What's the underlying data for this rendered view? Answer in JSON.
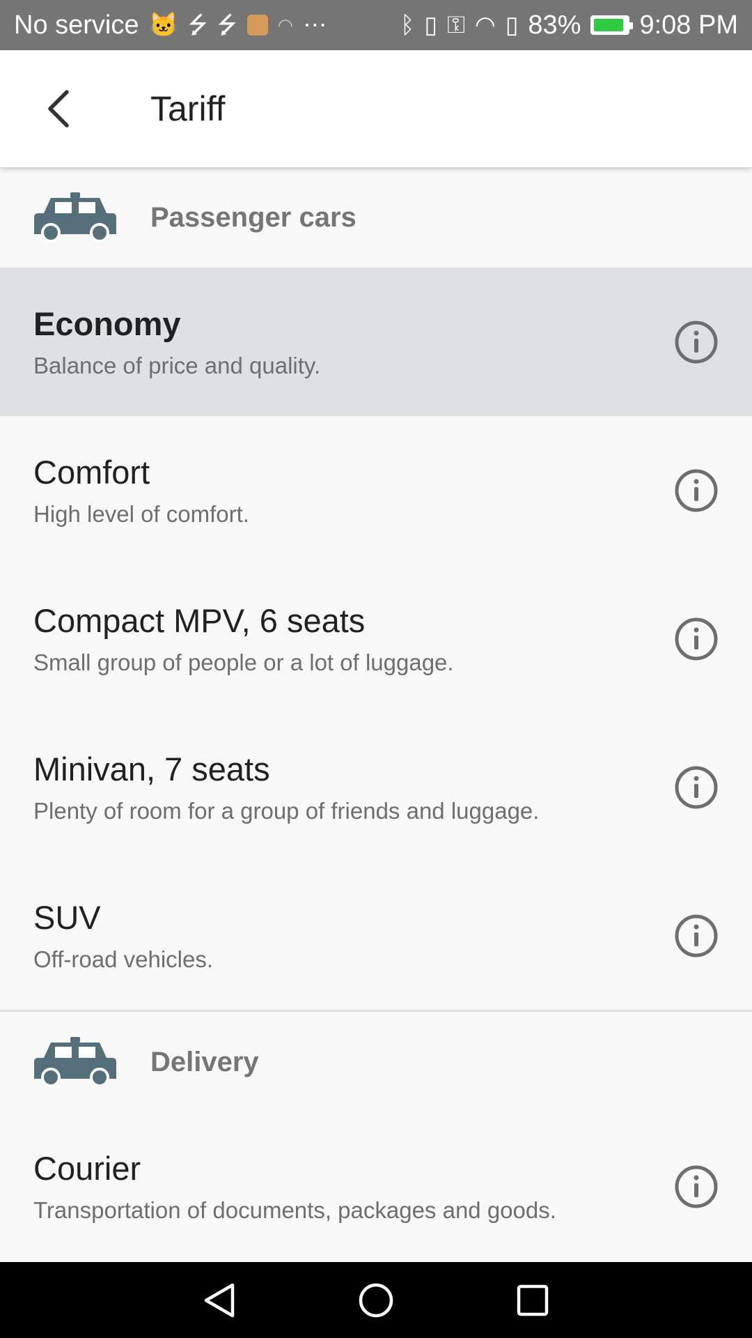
{
  "status_bar": {
    "carrier": "No service",
    "battery_percent": "83%",
    "time": "9:08 PM",
    "icons_left": [
      "cat-icon",
      "usb-icon",
      "usb-icon",
      "app-icon",
      "wifi-question-icon",
      "more-icon"
    ],
    "icons_right": [
      "bluetooth-icon",
      "vibrate-icon",
      "key-icon",
      "wifi-icon",
      "battery-alert-icon",
      "battery-icon"
    ]
  },
  "app_bar": {
    "title": "Tariff",
    "back_icon": "chevron-left-icon"
  },
  "sections": [
    {
      "title": "Passenger cars",
      "icon": "car-icon",
      "items": [
        {
          "title": "Economy",
          "description": "Balance of price and quality.",
          "selected": true
        },
        {
          "title": "Comfort",
          "description": "High level of comfort.",
          "selected": false
        },
        {
          "title": "Compact MPV, 6 seats",
          "description": "Small group of people or a lot of luggage.",
          "selected": false
        },
        {
          "title": "Minivan, 7 seats",
          "description": "Plenty of room for a group of friends and luggage.",
          "selected": false
        },
        {
          "title": "SUV",
          "description": "Off-road vehicles.",
          "selected": false
        }
      ]
    },
    {
      "title": "Delivery",
      "icon": "car-icon",
      "items": [
        {
          "title": "Courier",
          "description": "Transportation of documents, packages and goods.",
          "selected": false
        }
      ]
    }
  ],
  "nav_bar": {
    "buttons": [
      "back-triangle-icon",
      "home-circle-icon",
      "recents-square-icon"
    ]
  },
  "colors": {
    "status_bar": "#757575",
    "selected_row": "#dde1e4",
    "car_icon": "#546e7a",
    "info_icon": "#6e6e6e"
  }
}
